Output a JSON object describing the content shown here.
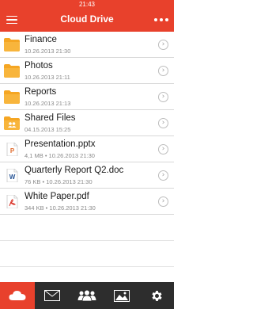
{
  "status_bar": {
    "time": "21:43"
  },
  "nav": {
    "title": "Cloud Drive"
  },
  "files": [
    {
      "type": "folder",
      "name": "Finance",
      "meta": "10.26.2013 21:30"
    },
    {
      "type": "folder",
      "name": "Photos",
      "meta": "10.26.2013 21:11"
    },
    {
      "type": "folder",
      "name": "Reports",
      "meta": "10.26.2013 21:13"
    },
    {
      "type": "shared-folder",
      "name": "Shared Files",
      "meta": "04.15.2013 15:25"
    },
    {
      "type": "pptx",
      "name": "Presentation.pptx",
      "meta": "4,1 MB  •  10.26.2013 21:30"
    },
    {
      "type": "doc",
      "name": "Quarterly Report Q2.doc",
      "meta": "76 KB  •  10.26.2013 21:30"
    },
    {
      "type": "pdf",
      "name": "White Paper.pdf",
      "meta": "344 KB  •  10.26.2013 21:30"
    }
  ],
  "tabs": [
    {
      "icon": "cloud-icon",
      "active": true
    },
    {
      "icon": "mail-icon",
      "active": false
    },
    {
      "icon": "contacts-icon",
      "active": false
    },
    {
      "icon": "photos-icon",
      "active": false
    },
    {
      "icon": "settings-icon",
      "active": false
    }
  ],
  "colors": {
    "accent": "#e8412c",
    "folder": "#f5a623",
    "tabbar": "#2d2d2d"
  }
}
